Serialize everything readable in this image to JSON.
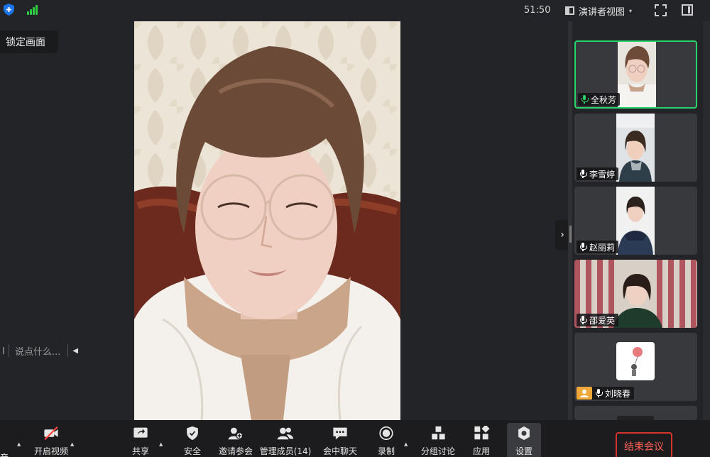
{
  "topbar": {
    "timer": "51:50",
    "view_label": "演讲者视图",
    "view_caret": "▾",
    "colors": {
      "signal": "#2ecc40",
      "shield": "#1a73e8"
    }
  },
  "lock_tooltip": "锁定画面",
  "chat": {
    "placeholder": "说点什么...",
    "toggle": "◀"
  },
  "panel_toggle": "›",
  "participants": [
    {
      "name": "全秋芳",
      "active": true
    },
    {
      "name": "李雪婷",
      "active": false
    },
    {
      "name": "赵丽莉",
      "active": false
    },
    {
      "name": "邵爱英",
      "active": false
    },
    {
      "name": "刘晓春",
      "active": false
    }
  ],
  "toolbar": {
    "audio_partial": "音",
    "video": "开启视频",
    "share": "共享",
    "security": "安全",
    "invite": "邀请参会",
    "participants": "管理成员(14)",
    "chat": "会中聊天",
    "record": "录制",
    "breakout": "分组讨论",
    "apps": "应用",
    "settings": "设置",
    "end": "结束会议",
    "end_color": "#d8342c"
  }
}
